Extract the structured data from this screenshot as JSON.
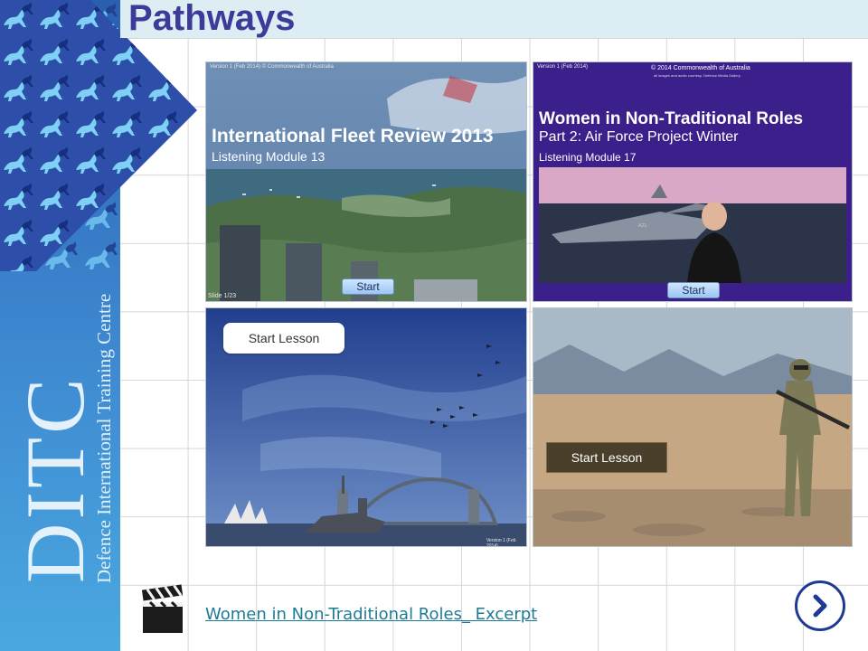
{
  "header": {
    "title": "Pathways"
  },
  "sidebar": {
    "logo_letters": "DITC",
    "logo_subtitle": "Defence International Training Centre"
  },
  "tiles": [
    {
      "id": "fleet",
      "tiny_top": "Version 1 (Feb 2014)   © Commonwealth of Australia",
      "title": "International Fleet Review 2013",
      "subtitle": "Listening Module 13",
      "slide": "Slide 1/23",
      "button": "Start"
    },
    {
      "id": "women",
      "tiny_top": "Version 1 (Feb 2014)",
      "copyright": "© 2014  Commonwealth of Australia",
      "copyright_sub": "all images and audio courtesy: Defence Media Gallery",
      "title": "Women in Non-Traditional Roles",
      "subtitle": "Part 2:  Air Force Project Winter",
      "subtitle2": "Listening Module 17",
      "jet_number": "A21-",
      "button": "Start"
    },
    {
      "id": "harbour",
      "button": "Start Lesson",
      "version": "Version 1 (Feb 2014)"
    },
    {
      "id": "soldier",
      "button": "Start Lesson"
    }
  ],
  "footer": {
    "link_text": "Women in Non-Traditional Roles_ Excerpt",
    "video_icon": "clapperboard-icon",
    "next_icon": "chevron-right-icon"
  },
  "colors": {
    "title": "#3d3a9a",
    "link": "#1e7b96",
    "next_border": "#1f3a93",
    "sidebar": "#3d86cf",
    "header_band": "#dceef3"
  }
}
